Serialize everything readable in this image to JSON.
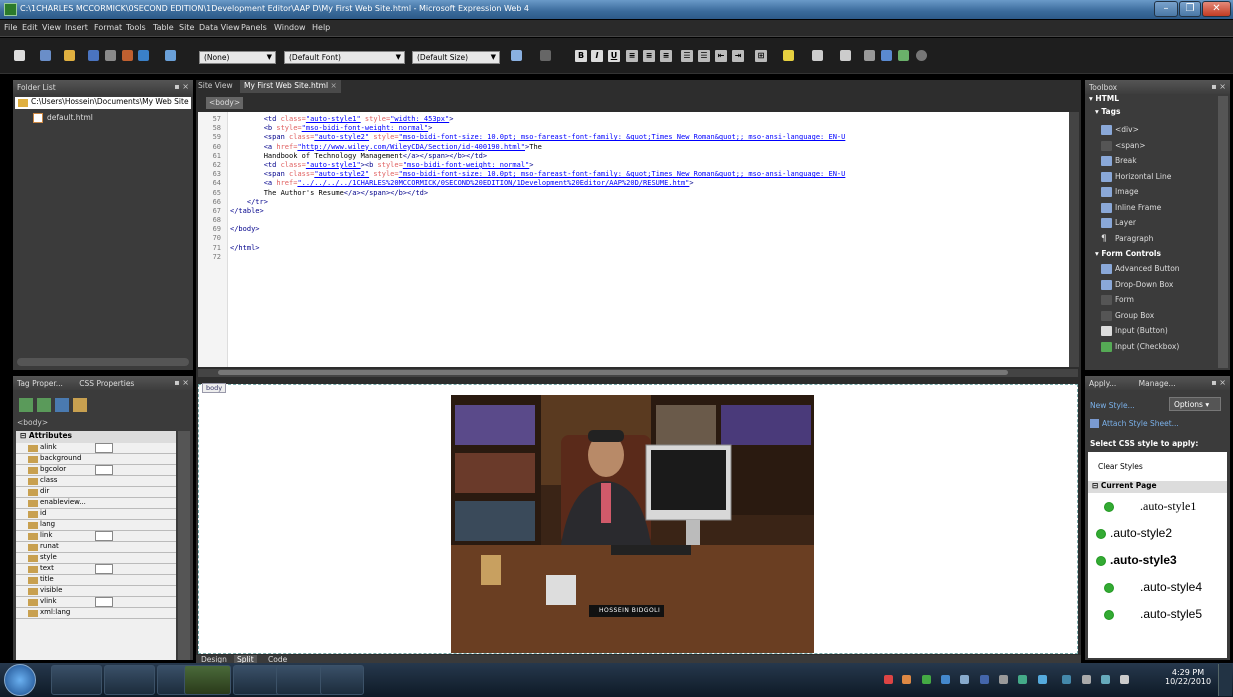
{
  "window": {
    "title": "C:\\1CHARLES MCCORMICK\\0SECOND EDITION\\1Development Editor\\AAP D\\My First Web Site.html - Microsoft Expression Web 4"
  },
  "menu": [
    "File",
    "Edit",
    "View",
    "Insert",
    "Format",
    "Tools",
    "Table",
    "Site",
    "Data View",
    "Panels",
    "Window",
    "Help"
  ],
  "toolbar": {
    "style_select": "(None)",
    "font_select": "(Default Font)",
    "size_select": "(Default Size)",
    "bold": "B",
    "italic": "I",
    "underline": "U"
  },
  "folder_list": {
    "title": "Folder List",
    "path": "C:\\Users\\Hossein\\Documents\\My Web Site",
    "file": "default.html"
  },
  "editor": {
    "tabs": [
      "Site View",
      "My First Web Site.html"
    ],
    "breadcrumb": "<body>",
    "line_numbers": [
      "57",
      "58",
      "59",
      "60",
      "61",
      "62",
      "63",
      "64",
      "65",
      "66",
      "67",
      "68",
      "69",
      "70",
      "71",
      "72"
    ],
    "lines": [
      [
        {
          "c": "tag",
          "t": "        <td "
        },
        {
          "c": "at",
          "t": "class="
        },
        {
          "c": "vl",
          "t": "\"auto-style1\""
        },
        {
          "c": "at",
          "t": " style="
        },
        {
          "c": "vl",
          "t": "\"width: 453px\""
        },
        {
          "c": "tag",
          "t": ">"
        }
      ],
      [
        {
          "c": "tag",
          "t": "        <b "
        },
        {
          "c": "at",
          "t": "style="
        },
        {
          "c": "vl",
          "t": "\"mso-bidi-font-weight: normal\""
        },
        {
          "c": "tag",
          "t": ">"
        }
      ],
      [
        {
          "c": "tag",
          "t": "        <span "
        },
        {
          "c": "at",
          "t": "class="
        },
        {
          "c": "vl",
          "t": "\"auto-style2\""
        },
        {
          "c": "at",
          "t": " style="
        },
        {
          "c": "vl",
          "t": "\"mso-bidi-font-size: 10.0pt; mso-fareast-font-family: &quot;Times New Roman&quot;; mso-ansi-language: EN-U"
        }
      ],
      [
        {
          "c": "tag",
          "t": "        <a "
        },
        {
          "c": "at",
          "t": "href="
        },
        {
          "c": "vl",
          "t": "\"http://www.wiley.com/WileyCDA/Section/id-400190.html\""
        },
        {
          "c": "tag",
          "t": ">"
        },
        {
          "c": "tx",
          "t": "The"
        }
      ],
      [
        {
          "c": "tx",
          "t": "        Handbook of Technology Management"
        },
        {
          "c": "tag",
          "t": "</a></span></b></td>"
        }
      ],
      [
        {
          "c": "tag",
          "t": "        <td "
        },
        {
          "c": "at",
          "t": "class="
        },
        {
          "c": "vl",
          "t": "\"auto-style1\""
        },
        {
          "c": "tag",
          "t": "><b "
        },
        {
          "c": "at",
          "t": "style="
        },
        {
          "c": "vl",
          "t": "\"mso-bidi-font-weight: normal\""
        },
        {
          "c": "tag",
          "t": ">"
        }
      ],
      [
        {
          "c": "tag",
          "t": "        <span "
        },
        {
          "c": "at",
          "t": "class="
        },
        {
          "c": "vl",
          "t": "\"auto-style2\""
        },
        {
          "c": "at",
          "t": " style="
        },
        {
          "c": "vl",
          "t": "\"mso-bidi-font-size: 10.0pt; mso-fareast-font-family: &quot;Times New Roman&quot;; mso-ansi-language: EN-U"
        }
      ],
      [
        {
          "c": "tag",
          "t": "        <a "
        },
        {
          "c": "at",
          "t": "href="
        },
        {
          "c": "vl",
          "t": "\"../../../../1CHARLES%20MCCORMICK/0SECOND%20EDITION/1Development%20Editor/AAP%20D/RESUME.htm\""
        },
        {
          "c": "tag",
          "t": ">"
        }
      ],
      [
        {
          "c": "tx",
          "t": "        The Author's Resume"
        },
        {
          "c": "tag",
          "t": "</a></span></b></td>"
        }
      ],
      [
        {
          "c": "tag",
          "t": "    </tr>"
        }
      ],
      [
        {
          "c": "tag",
          "t": "</table>"
        }
      ],
      [
        {
          "c": "tx",
          "t": ""
        }
      ],
      [
        {
          "c": "tag",
          "t": "</body>"
        }
      ],
      [
        {
          "c": "tx",
          "t": ""
        }
      ],
      [
        {
          "c": "tag",
          "t": "</html>"
        }
      ],
      [
        {
          "c": "tx",
          "t": ""
        }
      ]
    ],
    "design_tag": "body",
    "nameplate": "HOSSEIN BIDGOLI",
    "view_tabs": [
      "Design",
      "Split",
      "Code"
    ]
  },
  "tag_properties": {
    "tabs": [
      "Tag Proper...",
      "CSS Properties"
    ],
    "crumb": "<body>",
    "section": "Attributes",
    "attributes": [
      "alink",
      "background",
      "bgcolor",
      "class",
      "dir",
      "enableview...",
      "id",
      "lang",
      "link",
      "runat",
      "style",
      "text",
      "title",
      "visible",
      "vlink",
      "xml:lang"
    ]
  },
  "toolbox": {
    "title": "Toolbox",
    "html_label": "HTML",
    "tags_label": "Tags",
    "tags": [
      "<div>",
      "<span>",
      "Break",
      "Horizontal Line",
      "Image",
      "Inline Frame",
      "Layer",
      "Paragraph"
    ],
    "form_label": "Form Controls",
    "forms": [
      "Advanced Button",
      "Drop-Down Box",
      "Form",
      "Group Box",
      "Input (Button)",
      "Input (Checkbox)"
    ]
  },
  "apply_styles": {
    "tabs": [
      "Apply...",
      "Manage..."
    ],
    "new_style": "New Style...",
    "options": "Options",
    "attach": "Attach Style Sheet...",
    "select_label": "Select CSS style to apply:",
    "clear": "Clear Styles",
    "current_page": "Current Page",
    "styles": [
      ".auto-style1",
      ".auto-style2",
      ".auto-style3",
      ".auto-style4",
      ".auto-style5"
    ]
  },
  "clock": {
    "time": "4:29 PM",
    "date": "10/22/2010"
  }
}
